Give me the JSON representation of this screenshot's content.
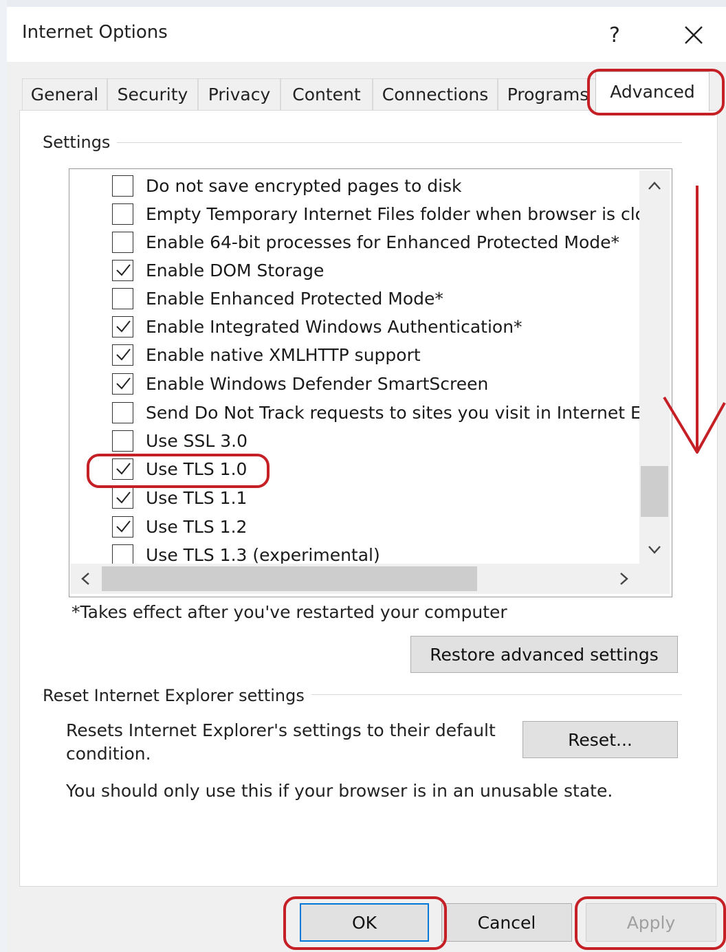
{
  "window": {
    "title": "Internet Options",
    "help_glyph": "?"
  },
  "tabs": [
    {
      "label": "General",
      "active": false
    },
    {
      "label": "Security",
      "active": false
    },
    {
      "label": "Privacy",
      "active": false
    },
    {
      "label": "Content",
      "active": false
    },
    {
      "label": "Connections",
      "active": false
    },
    {
      "label": "Programs",
      "active": false
    },
    {
      "label": "Advanced",
      "active": true
    }
  ],
  "settings": {
    "group_label": "Settings",
    "items": [
      {
        "label": "Do not save encrypted pages to disk",
        "checked": false
      },
      {
        "label": "Empty Temporary Internet Files folder when browser is clc",
        "checked": false
      },
      {
        "label": "Enable 64-bit processes for Enhanced Protected Mode*",
        "checked": false
      },
      {
        "label": "Enable DOM Storage",
        "checked": true
      },
      {
        "label": "Enable Enhanced Protected Mode*",
        "checked": false
      },
      {
        "label": "Enable Integrated Windows Authentication*",
        "checked": true
      },
      {
        "label": "Enable native XMLHTTP support",
        "checked": true
      },
      {
        "label": "Enable Windows Defender SmartScreen",
        "checked": true
      },
      {
        "label": "Send Do Not Track requests to sites you visit in Internet E",
        "checked": false
      },
      {
        "label": "Use SSL 3.0",
        "checked": false
      },
      {
        "label": "Use TLS 1.0",
        "checked": true
      },
      {
        "label": "Use TLS 1.1",
        "checked": true
      },
      {
        "label": "Use TLS 1.2",
        "checked": true
      },
      {
        "label": "Use TLS 1.3 (experimental)",
        "checked": false
      }
    ],
    "restart_note": "*Takes effect after you've restarted your computer",
    "restore_button": "Restore advanced settings"
  },
  "reset": {
    "group_label": "Reset Internet Explorer settings",
    "description": "Resets Internet Explorer's settings to their default condition.",
    "warning": "You should only use this if your browser is in an unusable state.",
    "reset_button": "Reset..."
  },
  "footer": {
    "ok": "OK",
    "cancel": "Cancel",
    "apply": "Apply"
  },
  "annotations": {
    "highlight_color": "#c42026",
    "highlighted": [
      "Advanced",
      "Use TLS 1.0",
      "OK",
      "Apply"
    ],
    "arrow_direction": "down"
  },
  "colors": {
    "dialog_bg": "#f0f0f0",
    "focus_border": "#0078d7",
    "disabled_text": "#a0a0a0"
  }
}
